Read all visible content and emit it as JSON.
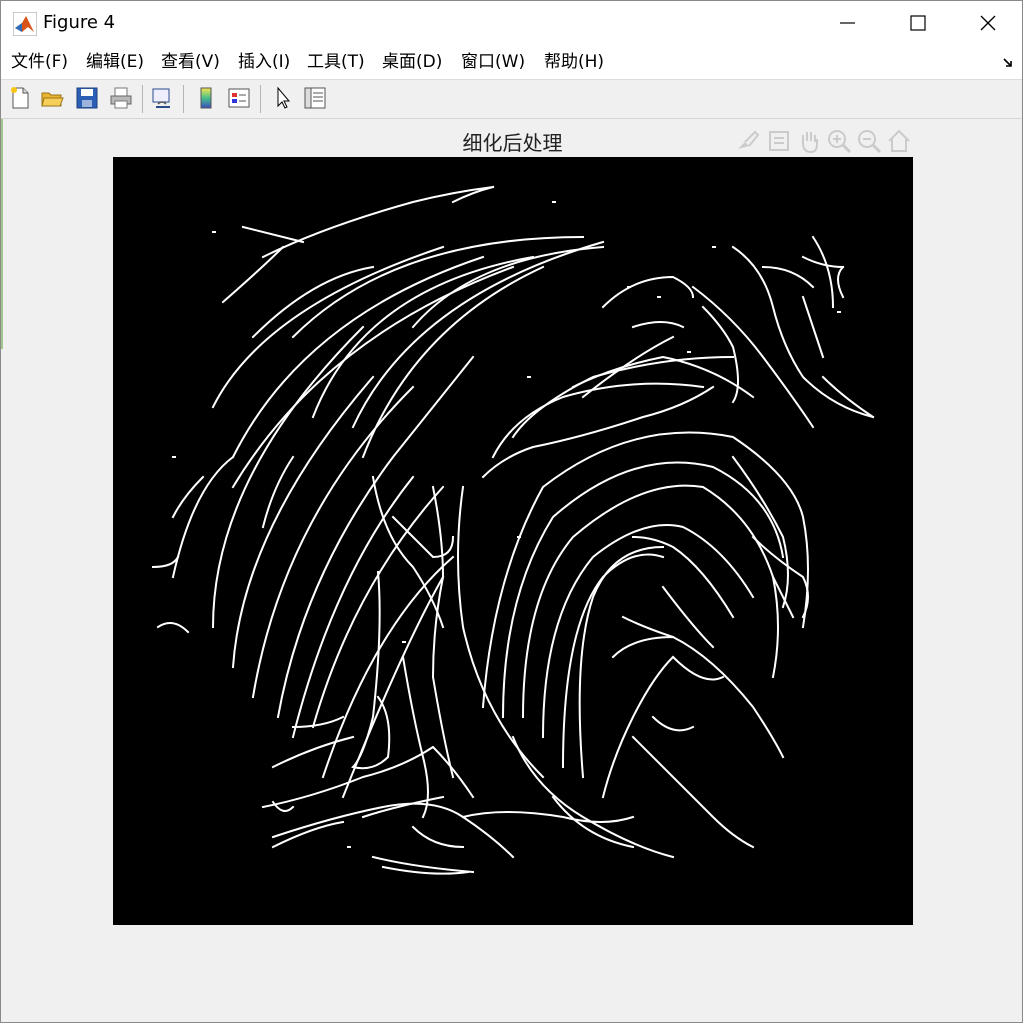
{
  "window": {
    "title": "Figure 4",
    "icon": "matlab-logo-icon"
  },
  "menubar": {
    "items": [
      "文件(F)",
      "编辑(E)",
      "查看(V)",
      "插入(I)",
      "工具(T)",
      "桌面(D)",
      "窗口(W)",
      "帮助(H)"
    ]
  },
  "toolbar": {
    "buttons": [
      "new-figure-icon",
      "open-file-icon",
      "save-icon",
      "print-icon",
      "link-plot-icon",
      "insert-colorbar-icon",
      "insert-legend-icon",
      "edit-plot-pointer-icon",
      "property-inspector-icon"
    ]
  },
  "axes": {
    "title": "细化后处理",
    "toolbar_icons": [
      "brush-icon",
      "data-tips-icon",
      "pan-hand-icon",
      "zoom-in-icon",
      "zoom-out-icon",
      "home-icon"
    ]
  },
  "image": {
    "description_icon": "thinned-fingerprint-image",
    "background": "#000000",
    "ridge_color": "#ffffff"
  }
}
